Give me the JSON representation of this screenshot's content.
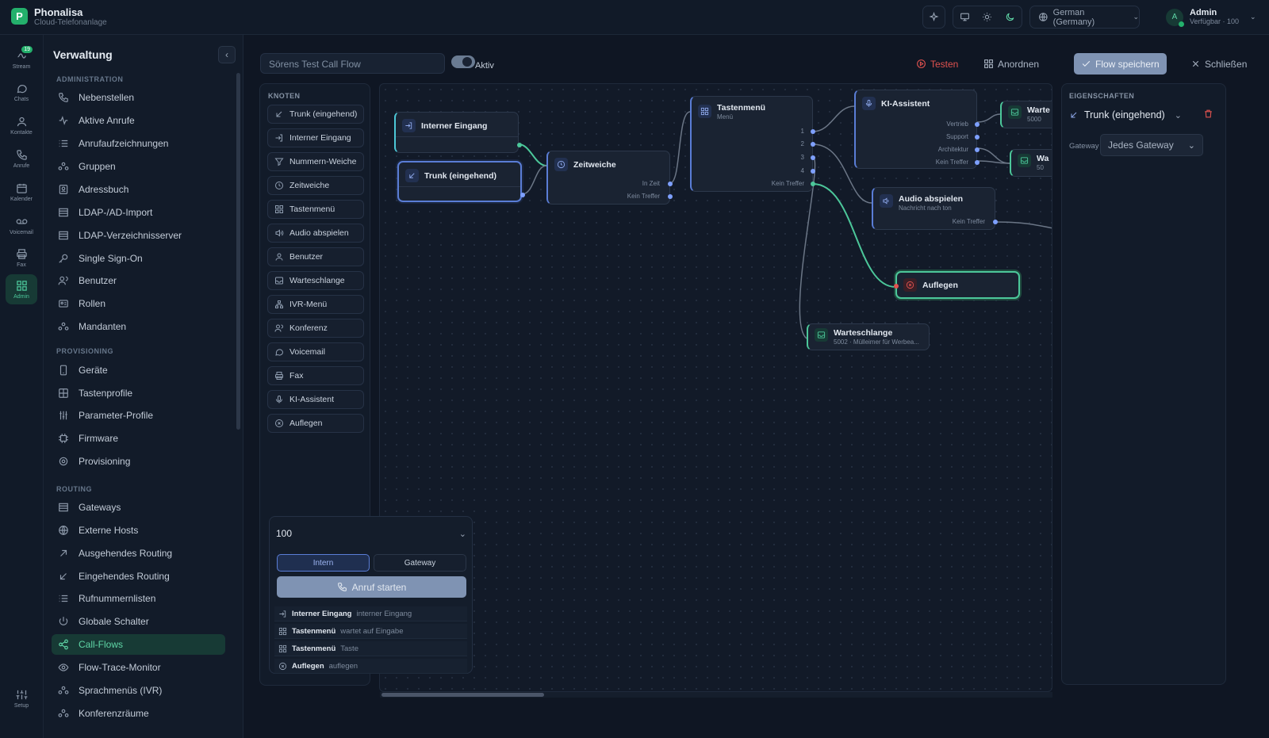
{
  "app": {
    "name": "Phonalisa",
    "subtitle": "Cloud-Telefonanlage"
  },
  "topbar": {
    "language": "German (Germany)",
    "user_name": "Admin",
    "user_status": "Verfügbar · 100",
    "avatar_initial": "A"
  },
  "rail": [
    {
      "label": "Stream",
      "badge": "19"
    },
    {
      "label": "Chats"
    },
    {
      "label": "Kontakte"
    },
    {
      "label": "Anrufe"
    },
    {
      "label": "Kalender"
    },
    {
      "label": "Voicemail"
    },
    {
      "label": "Fax"
    },
    {
      "label": "Admin"
    },
    {
      "label": "Setup"
    }
  ],
  "sidebar": {
    "title": "Verwaltung",
    "sections": [
      "ADMINISTRATION",
      "PROVISIONING",
      "ROUTING"
    ],
    "items": [
      "Nebenstellen",
      "Aktive Anrufe",
      "Anrufaufzeichnungen",
      "Gruppen",
      "Adressbuch",
      "LDAP-/AD-Import",
      "LDAP-Verzeichnisserver",
      "Single Sign-On",
      "Benutzer",
      "Rollen",
      "Mandanten",
      "Geräte",
      "Tastenprofile",
      "Parameter-Profile",
      "Firmware",
      "Provisioning",
      "Gateways",
      "Externe Hosts",
      "Ausgehendes Routing",
      "Eingehendes Routing",
      "Rufnummernlisten",
      "Globale Schalter",
      "Call-Flows",
      "Flow-Trace-Monitor",
      "Sprachmenüs (IVR)",
      "Konferenzräume"
    ]
  },
  "editor": {
    "flow_name": "Sörens Test Call Flow",
    "active_label": "Aktiv",
    "active": true,
    "actions": {
      "test": "Testen",
      "arrange": "Anordnen",
      "save": "Flow speichern",
      "close": "Schließen"
    }
  },
  "palette": {
    "title": "KNOTEN",
    "items": [
      "Trunk (eingehend)",
      "Interner Eingang",
      "Nummern-Weiche",
      "Zeitweiche",
      "Tastenmenü",
      "Audio abspielen",
      "Benutzer",
      "Warteschlange",
      "IVR-Menü",
      "Konferenz",
      "Voicemail",
      "Fax",
      "KI-Assistent",
      "Auflegen"
    ]
  },
  "nodes": {
    "internal": {
      "title": "Interner Eingang"
    },
    "trunk": {
      "title": "Trunk (eingehend)"
    },
    "time": {
      "title": "Zeitweiche",
      "ports": [
        "In Zeit",
        "Kein Treffer"
      ]
    },
    "menu": {
      "title": "Tastenmenü",
      "sub": "Menü",
      "ports": [
        "1",
        "2",
        "3",
        "4",
        "Kein Treffer"
      ]
    },
    "ai": {
      "title": "KI-Assistent",
      "ports": [
        "Vertrieb",
        "Support",
        "Architektur",
        "Kein Treffer"
      ]
    },
    "audio": {
      "title": "Audio abspielen",
      "sub": "Nachricht nach ton",
      "ports": [
        "Kein Treffer"
      ]
    },
    "hangup": {
      "title": "Auflegen"
    },
    "queue": {
      "title": "Warteschlange",
      "sub": "5002 · Mülleimer für Werbea..."
    },
    "queue_r1": {
      "title": "Warte",
      "sub": "5000"
    },
    "queue_r2": {
      "title": "Wa",
      "sub": "50"
    }
  },
  "properties": {
    "title": "EIGENSCHAFTEN",
    "node": "Trunk (eingehend)",
    "gateway_label": "Gateway",
    "gateway_value": "Jedes Gateway"
  },
  "dialer": {
    "number": "100",
    "tabs": [
      "Intern",
      "Gateway"
    ],
    "start": "Anruf starten",
    "trace": [
      {
        "name": "Interner Eingang",
        "desc": "interner Eingang"
      },
      {
        "name": "Tastenmenü",
        "desc": "wartet auf Eingabe"
      },
      {
        "name": "Tastenmenü",
        "desc": "Taste"
      },
      {
        "name": "Auflegen",
        "desc": "auflegen"
      }
    ]
  },
  "colors": {
    "accent": "#24b06c",
    "node_border": "#5a7dd6",
    "edge_active": "#4cc79a",
    "danger": "#e0524f"
  }
}
